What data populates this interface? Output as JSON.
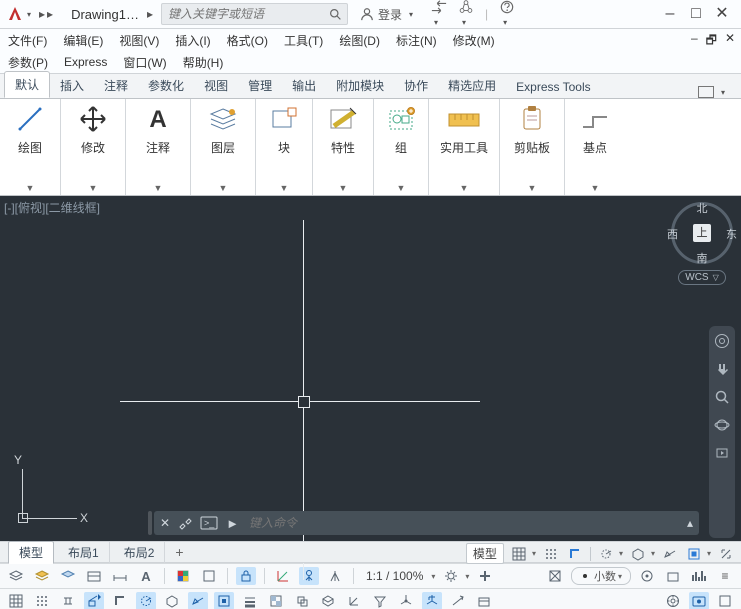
{
  "titlebar": {
    "filename": "Drawing1…",
    "search_placeholder": "键入关键字或短语",
    "login": "登录"
  },
  "menu": {
    "file": "文件(F)",
    "edit": "编辑(E)",
    "view": "视图(V)",
    "insert": "插入(I)",
    "format": "格式(O)",
    "tools": "工具(T)",
    "draw": "绘图(D)",
    "dimension": "标注(N)",
    "modify": "修改(M)",
    "parametric": "参数(P)",
    "express": "Express",
    "window": "窗口(W)",
    "help": "帮助(H)"
  },
  "tabs": {
    "home": "默认",
    "insert": "插入",
    "annotate": "注释",
    "parametric": "参数化",
    "view": "视图",
    "manage": "管理",
    "output": "输出",
    "addins": "附加模块",
    "collab": "协作",
    "featured": "精选应用",
    "express": "Express Tools"
  },
  "panels": {
    "draw": "绘图",
    "modify": "修改",
    "annotate": "注释",
    "layers": "图层",
    "block": "块",
    "properties": "特性",
    "group": "组",
    "utilities": "实用工具",
    "clipboard": "剪贴板",
    "basepoint": "基点"
  },
  "viewport": {
    "label": "[-][俯视][二维线框]",
    "compass": {
      "n": "北",
      "s": "南",
      "e": "东",
      "w": "西",
      "top": "上"
    },
    "wcs": "WCS",
    "ucs": {
      "x": "X",
      "y": "Y"
    }
  },
  "cmdline": {
    "prompt": "►",
    "placeholder": "键入命令"
  },
  "layout_tabs": {
    "model": "模型",
    "l1": "布局1",
    "l2": "布局2"
  },
  "status_right": {
    "model": "模型"
  },
  "status2": {
    "zoom": "1:1 / 100%",
    "units": "小数"
  }
}
